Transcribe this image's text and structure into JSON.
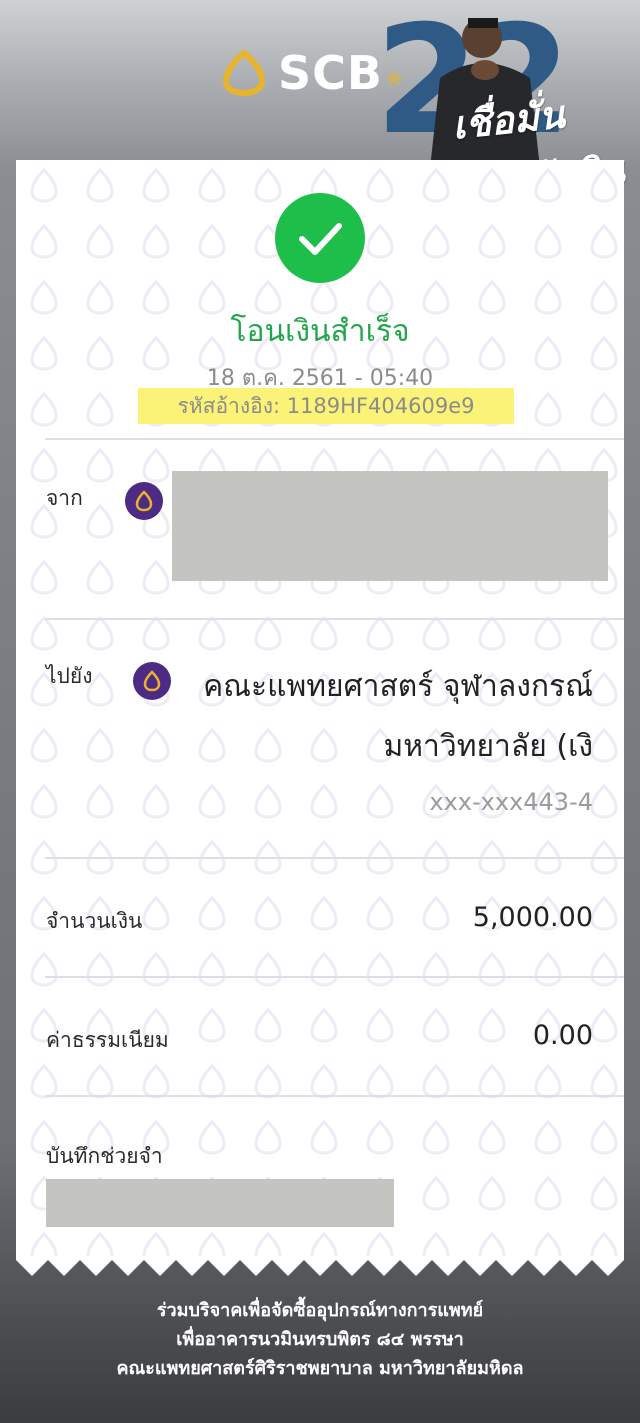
{
  "header": {
    "brand": "SCB",
    "campaign_number": "22",
    "campaign_tagline": "เชื่อมั่น กล้าตัดสิน"
  },
  "receipt": {
    "status_title": "โอนเงินสำเร็จ",
    "datetime": "18 ต.ค. 2561 - 05:40",
    "reference": "รหัสอ้างอิง: 1189HF404609e9",
    "from_label": "จาก",
    "to_label": "ไปยัง",
    "to_name_line1": "คณะแพทยศาสตร์ จุฬาลงกรณ์",
    "to_name_line2": "มหาวิทยาลัย (เงิ",
    "to_account": "xxx-xxx443-4",
    "amount_label": "จำนวนเงิน",
    "amount_value": "5,000.00",
    "fee_label": "ค่าธรรมเนียม",
    "fee_value": "0.00",
    "memo_label": "บันทึกช่วยจำ"
  },
  "footer": {
    "line1": "ร่วมบริจาคเพื่อจัดซื้ออุปกรณ์ทางการแพทย์",
    "line2": "เพื่ออาคารนวมินทรบพิตร ๘๔ พรรษา",
    "line3": "คณะแพทยศาสตร์ศิริราชพยาบาล มหาวิทยาลัยมหิดล"
  },
  "colors": {
    "success_green": "#1dbf4a",
    "title_green": "#23a64b",
    "highlight_yellow": "#fbf377",
    "scb_purple": "#4d2a84",
    "scb_gold": "#e7b42b"
  }
}
